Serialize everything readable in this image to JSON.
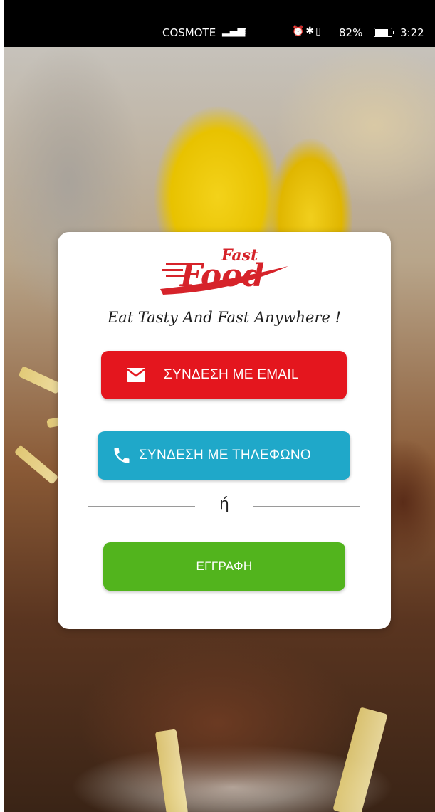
{
  "status_bar": {
    "carrier": "COSMOTE",
    "battery_percent": "82%",
    "time": "3:22"
  },
  "app": {
    "logo_small": "Fast",
    "logo_big": "Food",
    "tagline": "Eat Tasty And Fast Anywhere !"
  },
  "buttons": {
    "email_label": "ΣΥΝΔΕΣΗ ΜΕ EMAIL",
    "phone_label": "ΣΥΝΔΕΣΗ ΜΕ ΤΗΛΕΦΩΝΟ",
    "register_label": "ΕΓΓΡΑΦΗ"
  },
  "divider_text": "ή",
  "colors": {
    "email_button": "#e4161e",
    "phone_button": "#1fa8c9",
    "register_button": "#52b41d",
    "logo": "#d6232a"
  },
  "icons": {
    "email": "envelope-icon",
    "phone": "phone-icon"
  }
}
